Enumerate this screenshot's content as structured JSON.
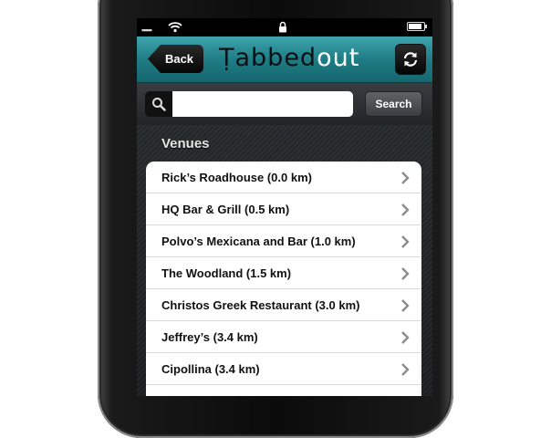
{
  "statusbar": {
    "signal": "▪▪▪▪▪",
    "wifi_icon": "wifi-icon",
    "lock_icon": "lock-icon",
    "battery_level": 0.85
  },
  "navbar": {
    "back_label": "Back",
    "logo_main": "Ṭabbed",
    "logo_accent": "out",
    "refresh_icon": "refresh-icon",
    "colors": {
      "teal": "#2a8c95",
      "button": "#111111"
    }
  },
  "search": {
    "value": "",
    "placeholder": "",
    "button_label": "Search"
  },
  "venues": {
    "header": "Venues",
    "items": [
      {
        "label": "Rick’s Roadhouse (0.0 km)"
      },
      {
        "label": "HQ Bar & Grill (0.5 km)"
      },
      {
        "label": "Polvo’s Mexicana and Bar (1.0 km)"
      },
      {
        "label": "The Woodland (1.5 km)"
      },
      {
        "label": "Christos Greek Restaurant (3.0 km)"
      },
      {
        "label": "Jeffrey’s (3.4 km)"
      },
      {
        "label": "Cipollina (3.4 km)"
      },
      {
        "label": ""
      }
    ]
  }
}
